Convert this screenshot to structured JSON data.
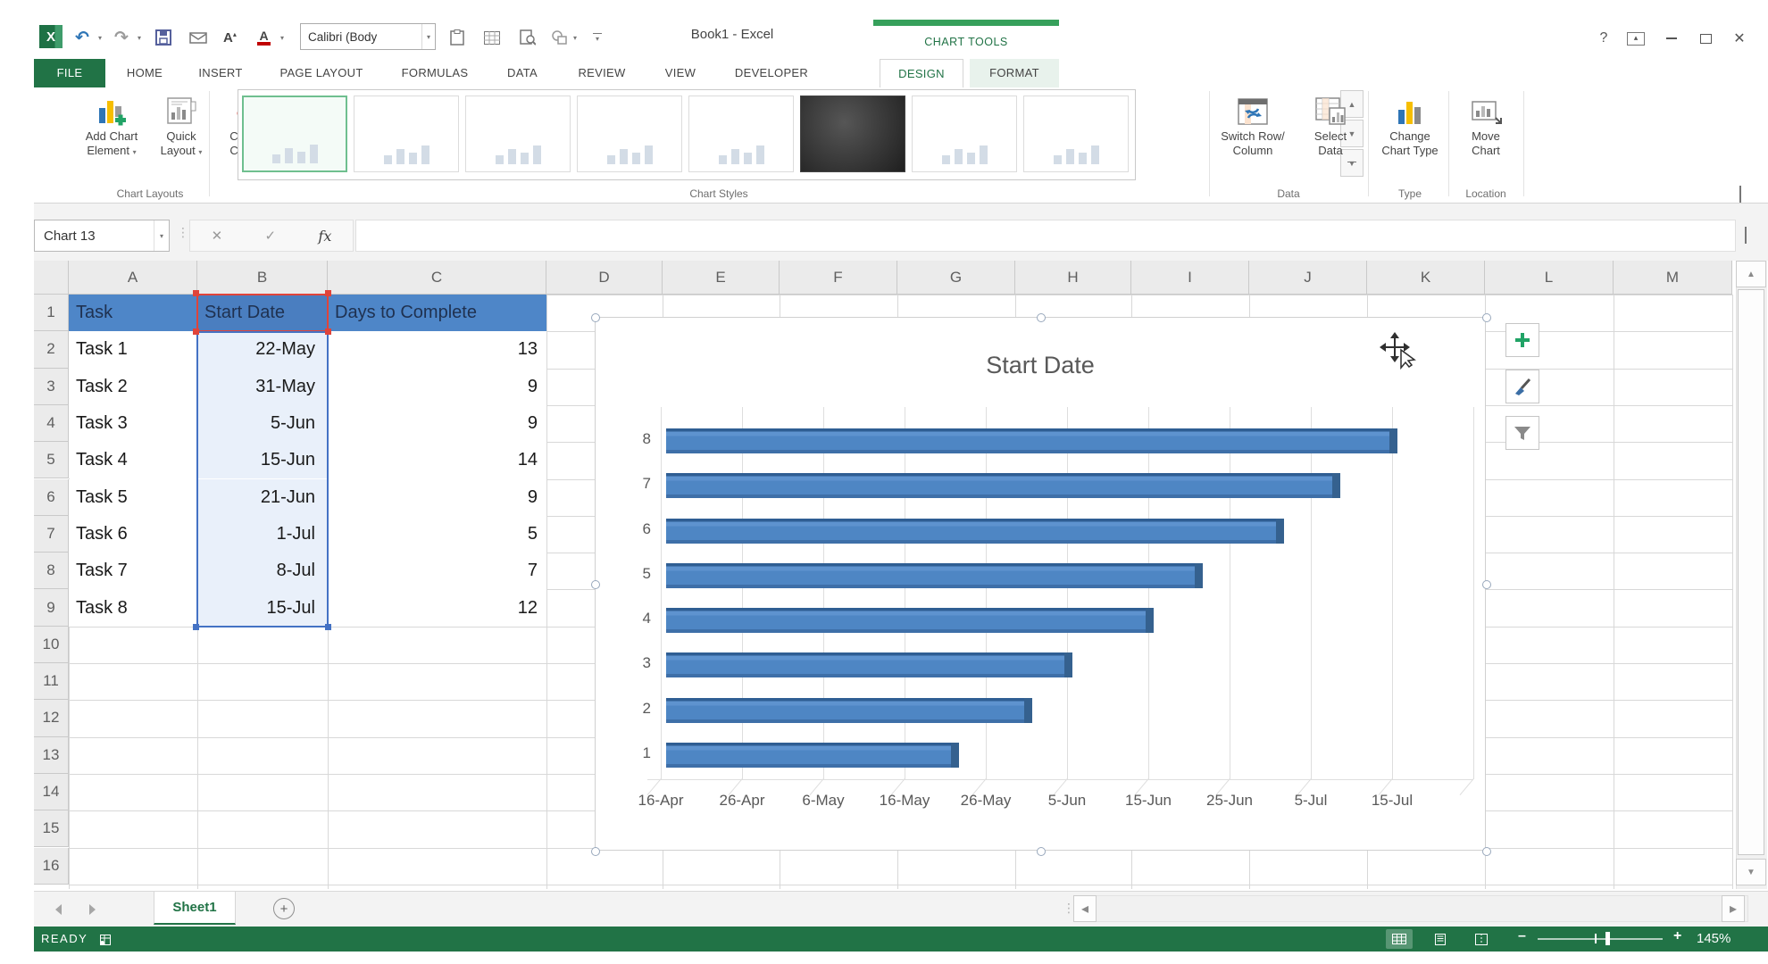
{
  "app": {
    "title": "Book1 - Excel"
  },
  "quick_access": {
    "font_box": "Calibri (Body"
  },
  "window_controls": {
    "help_label": "?"
  },
  "contextual": {
    "label": "CHART TOOLS"
  },
  "tabs": [
    {
      "label": "FILE"
    },
    {
      "label": "HOME"
    },
    {
      "label": "INSERT"
    },
    {
      "label": "PAGE LAYOUT"
    },
    {
      "label": "FORMULAS"
    },
    {
      "label": "DATA"
    },
    {
      "label": "REVIEW"
    },
    {
      "label": "VIEW"
    },
    {
      "label": "DEVELOPER"
    },
    {
      "label": "DESIGN",
      "active": true
    },
    {
      "label": "FORMAT"
    }
  ],
  "ribbon": {
    "groups": {
      "chart_layouts": "Chart Layouts",
      "chart_styles": "Chart Styles",
      "data": "Data",
      "type": "Type",
      "location": "Location"
    },
    "buttons": {
      "add_chart_element": [
        "Add Chart",
        "Element"
      ],
      "quick_layout": [
        "Quick",
        "Layout"
      ],
      "change_colors": [
        "Change",
        "Colors"
      ],
      "switch_row_column": [
        "Switch Row/",
        "Column"
      ],
      "select_data": [
        "Select",
        "Data"
      ],
      "change_chart_type": [
        "Change",
        "Chart Type"
      ],
      "move_chart": [
        "Move",
        "Chart"
      ]
    },
    "gallery": {
      "selected_index": 0,
      "items": [
        "light",
        "light",
        "light",
        "light",
        "light",
        "dark",
        "light",
        "light"
      ]
    }
  },
  "formula_bar": {
    "name_box": "Chart 13",
    "fx_label": "fx",
    "value": ""
  },
  "grid": {
    "columns": [
      "A",
      "B",
      "C",
      "D",
      "E",
      "F",
      "G",
      "H",
      "I",
      "J",
      "K",
      "L",
      "M"
    ],
    "rows": [
      "1",
      "2",
      "3",
      "4",
      "5",
      "6",
      "7",
      "8",
      "9",
      "10",
      "11",
      "12",
      "13",
      "14",
      "15",
      "16"
    ]
  },
  "sheet": {
    "header": [
      "Task",
      "Start Date",
      "Days to Complete"
    ],
    "data": [
      [
        "Task 1",
        "22-May",
        "13"
      ],
      [
        "Task 2",
        "31-May",
        "9"
      ],
      [
        "Task 3",
        "5-Jun",
        "9"
      ],
      [
        "Task 4",
        "15-Jun",
        "14"
      ],
      [
        "Task 5",
        "21-Jun",
        "9"
      ],
      [
        "Task 6",
        "1-Jul",
        "5"
      ],
      [
        "Task 7",
        "8-Jul",
        "7"
      ],
      [
        "Task 8",
        "15-Jul",
        "12"
      ]
    ]
  },
  "chart_data": {
    "type": "bar",
    "orientation": "horizontal",
    "style": "3d-horizontal-bar",
    "title": "Start Date",
    "categories": [
      "1",
      "2",
      "3",
      "4",
      "5",
      "6",
      "7",
      "8"
    ],
    "category_axis_order": "1 at bottom to 8 at top",
    "series": [
      {
        "name": "Start Date",
        "values_dates": [
          "22-May",
          "31-May",
          "5-Jun",
          "15-Jun",
          "21-Jun",
          "1-Jul",
          "8-Jul",
          "15-Jul"
        ],
        "values_days_from_axis_min": [
          36,
          45,
          50,
          60,
          66,
          76,
          83,
          90
        ]
      }
    ],
    "x_axis": {
      "min": "16-Apr",
      "max": "25-Jul",
      "tick_interval_days": 10,
      "span_days": 100,
      "tick_labels": [
        "16-Apr",
        "26-Apr",
        "6-May",
        "16-May",
        "26-May",
        "5-Jun",
        "15-Jun",
        "25-Jun",
        "5-Jul",
        "15-Jul"
      ]
    },
    "bar_color": "#4e86c4",
    "legend": "none",
    "grid": "vertical-gridlines-on"
  },
  "sheet_tabs": {
    "active": "Sheet1"
  },
  "status": {
    "mode": "READY",
    "zoom_percent": "145%"
  }
}
